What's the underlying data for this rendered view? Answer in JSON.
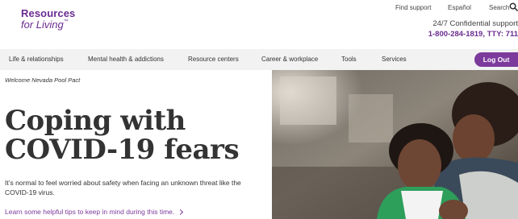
{
  "logo": {
    "line1": "Resources",
    "line2": "for Living",
    "mark": "™"
  },
  "utility": {
    "find_support": "Find support",
    "espanol": "Español",
    "search": "Search"
  },
  "support": {
    "line1": "24/7 Confidential support",
    "line2": "1-800-284-1819, TTY: 711"
  },
  "nav": {
    "items": [
      "Life & relationships",
      "Mental health & addictions",
      "Resource centers",
      "Career & workplace",
      "Tools",
      "Services"
    ],
    "logout": "Log Out"
  },
  "welcome": "Welcome Nevada Pool Pact",
  "headline": {
    "line1": "Coping with",
    "line2": "COVID-19 fears"
  },
  "intro": "It’s normal to feel worried about safety when facing an unknown threat like the COVID-19 virus.",
  "learn_more": "Learn some helpful tips to keep in mind during this time.",
  "icons": [
    "search-icon",
    "chevron-right-icon"
  ],
  "colors": {
    "brand_purple": "#6b2c91",
    "button_purple": "#7c3a9c",
    "nav_bg": "#f2f2f2"
  }
}
